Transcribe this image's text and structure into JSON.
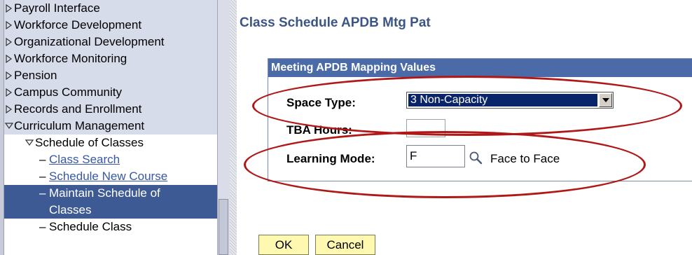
{
  "nav": {
    "top_items": [
      {
        "label": "Payroll Interface",
        "icon": "triangle-right-icon"
      },
      {
        "label": "Workforce Development",
        "icon": "triangle-right-icon"
      },
      {
        "label": "Organizational Development",
        "icon": "triangle-right-icon"
      },
      {
        "label": "Workforce Monitoring",
        "icon": "triangle-right-icon"
      },
      {
        "label": "Pension",
        "icon": "triangle-right-icon"
      },
      {
        "label": "Campus Community",
        "icon": "triangle-right-icon"
      },
      {
        "label": "Records and Enrollment",
        "icon": "triangle-right-icon"
      },
      {
        "label": "Curriculum Management",
        "icon": "triangle-down-icon"
      }
    ],
    "sub_section": {
      "label": "Schedule of Classes",
      "icon": "triangle-down-icon"
    },
    "links": [
      {
        "dash": "–",
        "label": "Class Search"
      },
      {
        "dash": "–",
        "label": "Schedule New Course"
      }
    ],
    "selected": {
      "dash": "–",
      "line1": "Maintain Schedule of",
      "line2": "Classes"
    },
    "after_selected": {
      "dash": "–",
      "label": "Schedule Class"
    }
  },
  "page": {
    "title": "Class Schedule APDB Mtg Pat"
  },
  "group": {
    "header": "Meeting APDB Mapping Values",
    "space_type_label": "Space Type:",
    "space_type_value": "3 Non-Capacity",
    "tba_hours_label": "TBA Hours:",
    "tba_hours_value": "",
    "learning_mode_label": "Learning Mode:",
    "learning_mode_value": "F",
    "learning_mode_desc": "Face to Face"
  },
  "buttons": {
    "ok": "OK",
    "cancel": "Cancel"
  },
  "colors": {
    "title": "#3c5585",
    "group_header": "#4a6aa8",
    "nav_selected": "#3d5a94",
    "highlight": "#b01818",
    "button_bg": "#fff8b0"
  }
}
